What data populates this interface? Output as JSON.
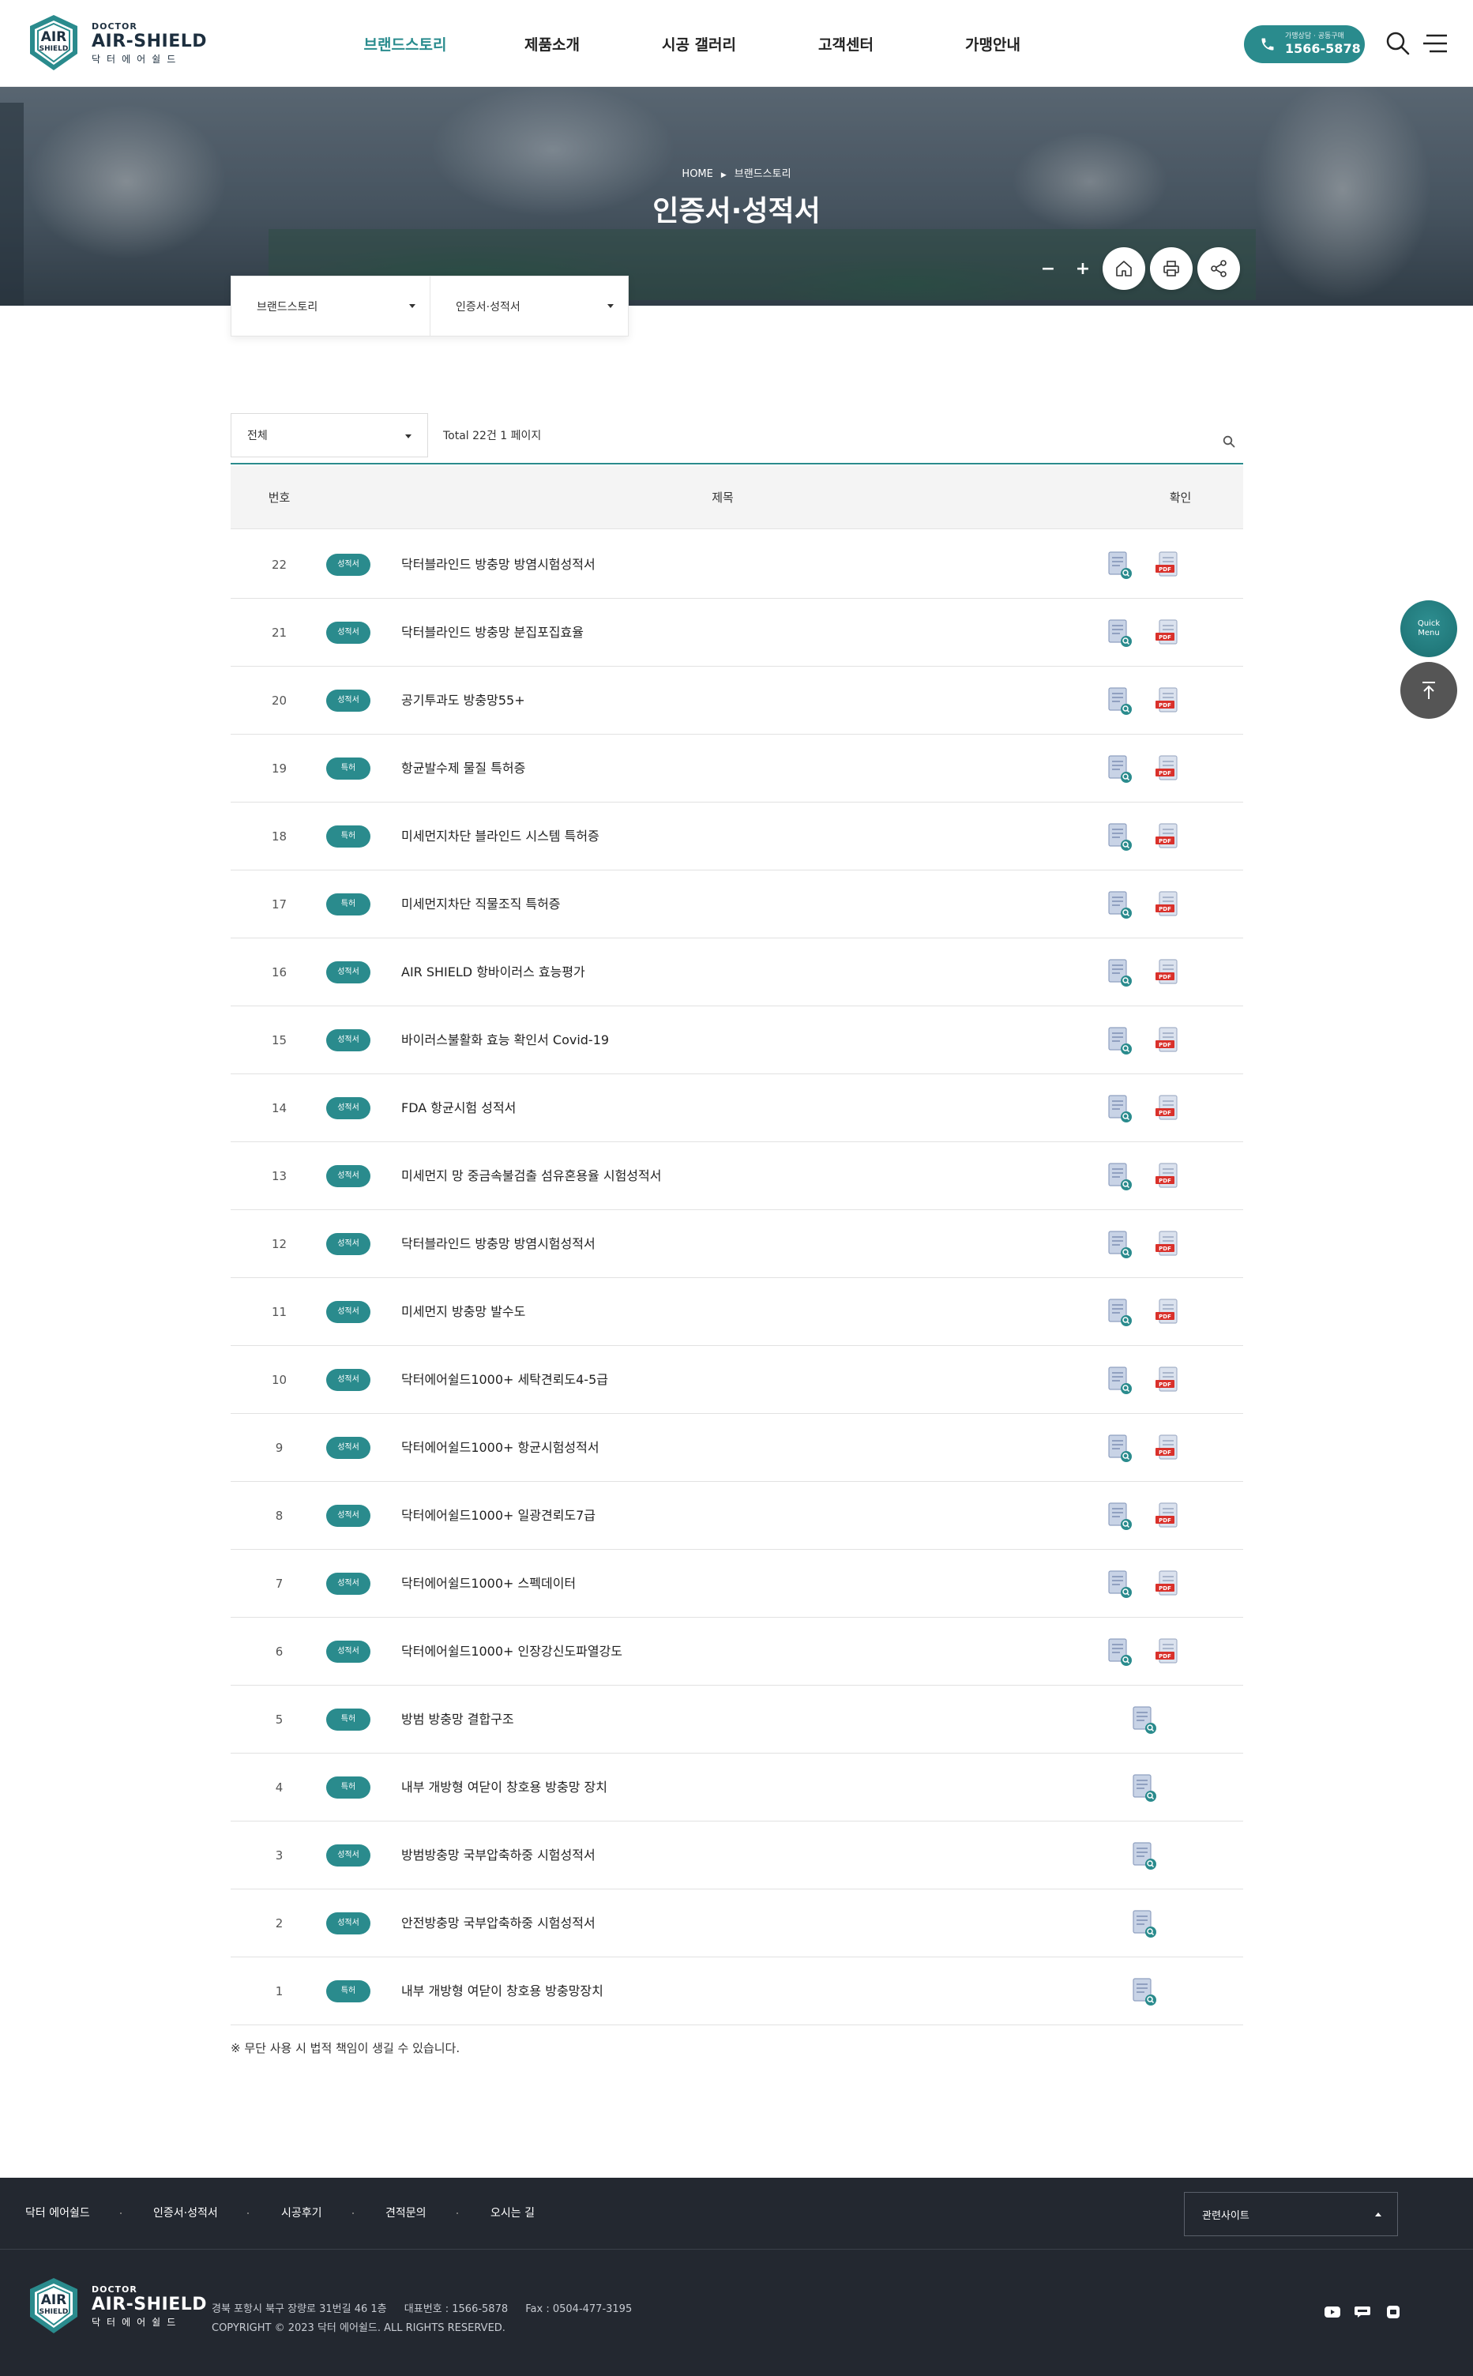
{
  "brand": {
    "doctor": "DOCTOR",
    "name": "AIR-SHIELD",
    "korean": "닥터에어쉴드",
    "badge_line1": "AIR",
    "badge_line2": "SHIELD",
    "colors": {
      "primary": "#2a8b8d",
      "dark": "#232830",
      "pdf_red": "#d9312b"
    }
  },
  "nav": {
    "items": [
      {
        "label": "브랜드스토리",
        "active": true
      },
      {
        "label": "제품소개",
        "active": false
      },
      {
        "label": "시공 갤러리",
        "active": false
      },
      {
        "label": "고객센터",
        "active": false
      },
      {
        "label": "가맹안내",
        "active": false
      }
    ]
  },
  "tel": {
    "caption": "가맹상담 · 공동구매",
    "number": "1566-5878",
    "icon": "phone-icon"
  },
  "header_icons": {
    "search": "search-icon",
    "menu": "hamburger-icon"
  },
  "visual": {
    "breadcrumb_home": "HOME",
    "breadcrumb_current": "브랜드스토리",
    "title": "인증서·성적서",
    "font_minus": "−",
    "font_plus": "+",
    "util_icons": [
      "home-icon",
      "print-icon",
      "share-icon"
    ]
  },
  "subnav": {
    "depth1": "브랜드스토리",
    "depth2": "인증서·성적서"
  },
  "board": {
    "filter": "전체",
    "total": "Total 22건 1 페이지",
    "headers": {
      "num": "번호",
      "title": "제목",
      "confirm": "확인"
    },
    "rows": [
      {
        "num": "22",
        "badge": "성적서",
        "title": "닥터블라인드 방충망 방염시험성적서",
        "pdf": true
      },
      {
        "num": "21",
        "badge": "성적서",
        "title": "닥터블라인드 방충망 분집포집효율",
        "pdf": true
      },
      {
        "num": "20",
        "badge": "성적서",
        "title": "공기투과도 방충망55+",
        "pdf": true
      },
      {
        "num": "19",
        "badge": "특허",
        "title": "항균발수제 물질 특허증",
        "pdf": true
      },
      {
        "num": "18",
        "badge": "특허",
        "title": "미세먼지차단 블라인드 시스템 특허증",
        "pdf": true
      },
      {
        "num": "17",
        "badge": "특허",
        "title": "미세먼지차단 직물조직 특허증",
        "pdf": true
      },
      {
        "num": "16",
        "badge": "성적서",
        "title": "AIR SHIELD 항바이러스 효능평가",
        "pdf": true
      },
      {
        "num": "15",
        "badge": "성적서",
        "title": "바이러스불활화 효능 확인서 Covid-19",
        "pdf": true
      },
      {
        "num": "14",
        "badge": "성적서",
        "title": "FDA 항균시험 성적서",
        "pdf": true
      },
      {
        "num": "13",
        "badge": "성적서",
        "title": "미세먼지 망 중금속불검출 섬유혼용율 시험성적서",
        "pdf": true
      },
      {
        "num": "12",
        "badge": "성적서",
        "title": "닥터블라인드 방충망 방염시험성적서",
        "pdf": true
      },
      {
        "num": "11",
        "badge": "성적서",
        "title": "미세먼지 방충망 발수도",
        "pdf": true
      },
      {
        "num": "10",
        "badge": "성적서",
        "title": "닥터에어쉴드1000+ 세탁견뢰도4-5급",
        "pdf": true
      },
      {
        "num": "9",
        "badge": "성적서",
        "title": "닥터에어쉴드1000+ 항균시험성적서",
        "pdf": true
      },
      {
        "num": "8",
        "badge": "성적서",
        "title": "닥터에어쉴드1000+ 일광견뢰도7급",
        "pdf": true
      },
      {
        "num": "7",
        "badge": "성적서",
        "title": "닥터에어쉴드1000+ 스펙데이터",
        "pdf": true
      },
      {
        "num": "6",
        "badge": "성적서",
        "title": "닥터에어쉴드1000+ 인장강신도파열강도",
        "pdf": true
      },
      {
        "num": "5",
        "badge": "특허",
        "title": "방범 방충망 결합구조",
        "pdf": false
      },
      {
        "num": "4",
        "badge": "특허",
        "title": "내부 개방형 여닫이 창호용 방충망 장치",
        "pdf": false
      },
      {
        "num": "3",
        "badge": "성적서",
        "title": "방범방충망 국부압축하중 시험성적서",
        "pdf": false
      },
      {
        "num": "2",
        "badge": "성적서",
        "title": "안전방충망 국부압축하중 시험성적서",
        "pdf": false
      },
      {
        "num": "1",
        "badge": "특허",
        "title": "내부 개방형 여닫이 창호용 방충망장치",
        "pdf": false
      }
    ],
    "pdf_label": "PDF",
    "notice": "※ 무단 사용 시 법적 책임이 생길 수 있습니다."
  },
  "quick": {
    "line1": "Quick",
    "line2": "Menu",
    "top_icon": "arrow-up-icon"
  },
  "footer": {
    "links": [
      "닥터 에어쉴드",
      "인증서·성적서",
      "시공후기",
      "견적문의",
      "오시는 길"
    ],
    "family": "관련사이트",
    "address": "경북 포항시 북구 장량로 31번길 46 1층",
    "phone": "대표번호 : 1566-5878",
    "fax": "Fax : 0504-477-3195",
    "copyright": "COPYRIGHT © 2023 닥터 에어쉴드. ALL RIGHTS RESERVED.",
    "sns": [
      "youtube-icon",
      "talk-icon",
      "blog-icon"
    ]
  }
}
